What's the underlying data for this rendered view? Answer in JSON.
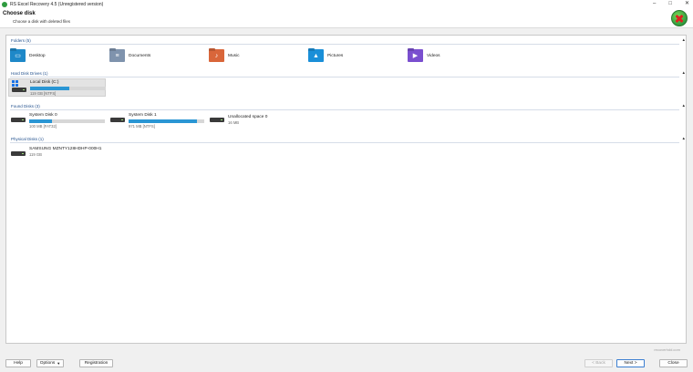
{
  "window": {
    "title": "RS Excel Recovery 4.5 (Unregistered version)",
    "controls": [
      "–",
      "□",
      "✕"
    ]
  },
  "header": {
    "title": "Choose disk",
    "subtitle": "Choose a disk with deleted files"
  },
  "sections": {
    "folders": {
      "label": "Folders (5)",
      "items": [
        {
          "label": "Desktop",
          "icon": "desktop-folder-icon"
        },
        {
          "label": "Documents",
          "icon": "documents-folder-icon"
        },
        {
          "label": "Music",
          "icon": "music-folder-icon"
        },
        {
          "label": "Pictures",
          "icon": "pictures-folder-icon"
        },
        {
          "label": "Videos",
          "icon": "videos-folder-icon"
        }
      ]
    },
    "hard_disk_drives": {
      "label": "Hard Disk Drives (1)",
      "items": [
        {
          "name": "Local Disk (C:)",
          "info": "119 GB [NTFS]",
          "used_fraction": 0.52
        }
      ]
    },
    "found_disks": {
      "label": "Found Disks (3)",
      "items": [
        {
          "name": "System Disk 0",
          "info": "100 MB [FAT32]",
          "used_fraction": 0.3
        },
        {
          "name": "System Disk 1",
          "info": "971 MB [NTFS]",
          "used_fraction": 0.9
        },
        {
          "name": "Unallocated space 0",
          "info": "16 MB"
        }
      ]
    },
    "physical_disks": {
      "label": "Physical Disks (1)",
      "items": [
        {
          "name": "SAMSUNG MZNTY128HDHP-000H1",
          "info": "119 GB"
        }
      ]
    }
  },
  "watermark": "recoverhdd.com",
  "footer": {
    "help": "Help",
    "options": "Options",
    "registration": "Registration",
    "back": "< Back",
    "next": "Next >",
    "close": "Close"
  },
  "colors": {
    "accent": "#2a96d4",
    "section_label": "#1f4e8c"
  }
}
